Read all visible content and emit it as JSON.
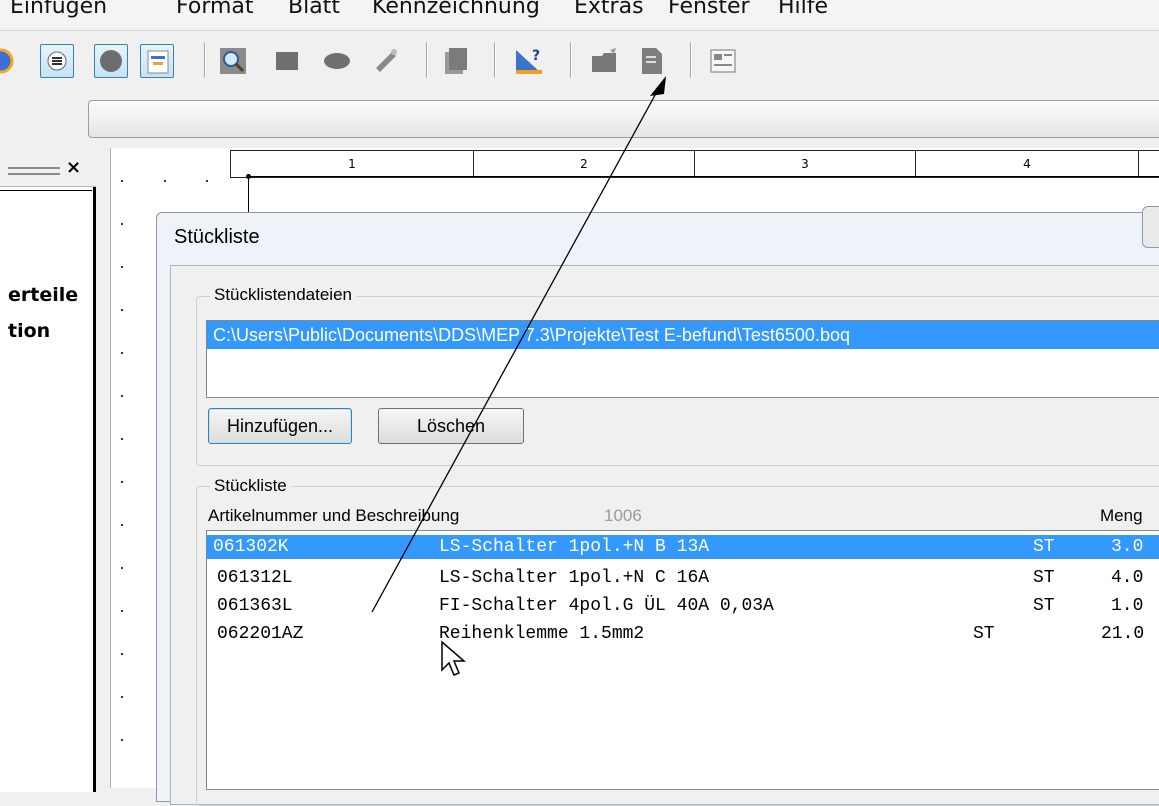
{
  "menu": [
    {
      "label": "Einfügen"
    },
    {
      "label": "Format"
    },
    {
      "label": "Blatt"
    },
    {
      "label": "Kennzeichnung"
    },
    {
      "label": "Extras"
    },
    {
      "label": "Fenster"
    },
    {
      "label": "Hilfe"
    }
  ],
  "ruler": [
    "1",
    "2",
    "3",
    "4"
  ],
  "left_panel": {
    "line1": "erteile",
    "line2": "tion",
    "close": "×"
  },
  "dialog": {
    "title": "Stückliste",
    "files_group": "Stücklistendateien",
    "file_path": "C:\\Users\\Public\\Documents\\DDS\\MEP 7.3\\Projekte\\Test E-befund\\Test6500.boq",
    "add_button": "Hinzufügen...",
    "delete_button": "Löschen",
    "list_group": "Stückliste",
    "col_header": "Artikelnummer und Beschreibung",
    "col_number": "1006",
    "col_menge": "Meng",
    "rows": [
      {
        "art": "061302K",
        "desc": "LS-Schalter 1pol.+N B 13A",
        "unit": "ST",
        "qty": "3.0"
      },
      {
        "art": "061312L",
        "desc": "LS-Schalter 1pol.+N C 16A",
        "unit": "ST",
        "qty": "4.0"
      },
      {
        "art": "061363L",
        "desc": "FI-Schalter 4pol.G ÜL 40A 0,03A",
        "unit": "ST",
        "qty": "1.0"
      },
      {
        "art": "062201AZ",
        "desc": "Reihenklemme 1.5mm2",
        "unit": "ST",
        "qty": "21.0"
      }
    ]
  },
  "colors": {
    "selection": "#3399ff",
    "dialog_bg": "#f0f0f0"
  }
}
